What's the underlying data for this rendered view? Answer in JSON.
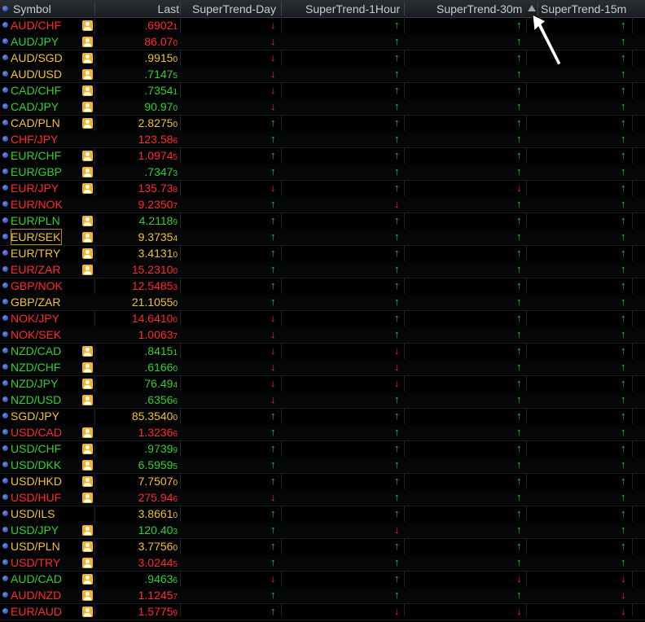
{
  "columns": {
    "symbol": "Symbol",
    "last": "Last",
    "st_day": "SuperTrend-Day",
    "st_1h": "SuperTrend-1Hour",
    "st_30m": "SuperTrend-30m",
    "st_15m": "SuperTrend-15m"
  },
  "colors": {
    "red": "#ff2a2a",
    "green": "#2ed12e",
    "orange": "#f2c12e"
  },
  "rows": [
    {
      "symbol": "AUD/CHF",
      "color": "red",
      "badge": true,
      "last": ".6902",
      "last_tail": "1",
      "day": "down",
      "h1": "up",
      "m30": "up",
      "m15": "up"
    },
    {
      "symbol": "AUD/JPY",
      "color": "green",
      "badge": true,
      "last": "86.07",
      "last_tail": "0",
      "last_color": "red",
      "day": "down",
      "h1": "up",
      "m30": "up",
      "m15": "up"
    },
    {
      "symbol": "AUD/SGD",
      "color": "orange",
      "badge": true,
      "last": ".9915",
      "last_tail": "0",
      "day": "down",
      "h1": "up",
      "m30": "up",
      "m15": "up"
    },
    {
      "symbol": "AUD/USD",
      "color": "orange",
      "badge": true,
      "last": ".7147",
      "last_tail": "5",
      "last_color": "green",
      "day": "down",
      "h1": "up",
      "m30": "up",
      "m15": "up"
    },
    {
      "symbol": "CAD/CHF",
      "color": "green",
      "badge": true,
      "last": ".7354",
      "last_tail": "1",
      "day": "down",
      "h1": "up",
      "m30": "up",
      "m15": "up"
    },
    {
      "symbol": "CAD/JPY",
      "color": "green",
      "badge": true,
      "last": "90.97",
      "last_tail": "0",
      "day": "down",
      "h1": "up",
      "m30": "up",
      "m15": "up"
    },
    {
      "symbol": "CAD/PLN",
      "color": "orange",
      "badge": true,
      "last": "2.8275",
      "last_tail": "0",
      "day": "up",
      "h1": "up",
      "m30": "up",
      "m15": "up"
    },
    {
      "symbol": "CHF/JPY",
      "color": "red",
      "badge": false,
      "last": "123.58",
      "last_tail": "6",
      "day": "up",
      "h1": "up",
      "m30": "up",
      "m15": "up"
    },
    {
      "symbol": "EUR/CHF",
      "color": "green",
      "badge": true,
      "last": "1.0974",
      "last_tail": "5",
      "last_color": "red",
      "day": "up",
      "h1": "up",
      "m30": "up",
      "m15": "up"
    },
    {
      "symbol": "EUR/GBP",
      "color": "green",
      "badge": true,
      "last": ".7347",
      "last_tail": "3",
      "day": "up",
      "h1": "up",
      "m30": "up",
      "m15": "up"
    },
    {
      "symbol": "EUR/JPY",
      "color": "red",
      "badge": true,
      "last": "135.73",
      "last_tail": "8",
      "day": "down",
      "h1": "up",
      "m30": "down",
      "m15": "up"
    },
    {
      "symbol": "EUR/NOK",
      "color": "red",
      "badge": false,
      "last": "9.2350",
      "last_tail": "7",
      "day": "up",
      "h1": "down",
      "m30": "up",
      "m15": "up"
    },
    {
      "symbol": "EUR/PLN",
      "color": "green",
      "badge": true,
      "last": "4.2118",
      "last_tail": "9",
      "day": "up",
      "h1": "up",
      "m30": "up",
      "m15": "up"
    },
    {
      "symbol": "EUR/SEK",
      "color": "orange",
      "badge": true,
      "last": "9.3735",
      "last_tail": "4",
      "day": "up",
      "h1": "up",
      "m30": "up",
      "m15": "up",
      "selected": true
    },
    {
      "symbol": "EUR/TRY",
      "color": "orange",
      "badge": true,
      "last": "3.4131",
      "last_tail": "0",
      "day": "up",
      "h1": "up",
      "m30": "up",
      "m15": "up"
    },
    {
      "symbol": "EUR/ZAR",
      "color": "red",
      "badge": true,
      "last": "15.2310",
      "last_tail": "0",
      "day": "up",
      "h1": "up",
      "m30": "up",
      "m15": "up"
    },
    {
      "symbol": "GBP/NOK",
      "color": "red",
      "badge": false,
      "last": "12.5485",
      "last_tail": "3",
      "day": "up",
      "h1": "up",
      "m30": "up",
      "m15": "up"
    },
    {
      "symbol": "GBP/ZAR",
      "color": "orange",
      "badge": false,
      "last": "21.1055",
      "last_tail": "0",
      "day": "up",
      "h1": "up",
      "m30": "up",
      "m15": "up"
    },
    {
      "symbol": "NOK/JPY",
      "color": "red",
      "badge": false,
      "last": "14.6410",
      "last_tail": "0",
      "day": "down",
      "h1": "up",
      "m30": "up",
      "m15": "up"
    },
    {
      "symbol": "NOK/SEK",
      "color": "red",
      "badge": false,
      "last": "1.0063",
      "last_tail": "7",
      "day": "down",
      "h1": "up",
      "m30": "up",
      "m15": "up"
    },
    {
      "symbol": "NZD/CAD",
      "color": "green",
      "badge": true,
      "last": ".8415",
      "last_tail": "1",
      "day": "down",
      "h1": "down",
      "m30": "up",
      "m15": "up"
    },
    {
      "symbol": "NZD/CHF",
      "color": "green",
      "badge": true,
      "last": ".6166",
      "last_tail": "0",
      "day": "down",
      "h1": "down",
      "m30": "up",
      "m15": "up"
    },
    {
      "symbol": "NZD/JPY",
      "color": "green",
      "badge": true,
      "last": "76.49",
      "last_tail": "4",
      "day": "down",
      "h1": "down",
      "m30": "up",
      "m15": "up"
    },
    {
      "symbol": "NZD/USD",
      "color": "green",
      "badge": true,
      "last": ".6356",
      "last_tail": "6",
      "last_color": "green",
      "day": "down",
      "h1": "up",
      "m30": "up",
      "m15": "up"
    },
    {
      "symbol": "SGD/JPY",
      "color": "orange",
      "badge": false,
      "last": "85.3540",
      "last_tail": "0",
      "day": "up",
      "h1": "up",
      "m30": "up",
      "m15": "up"
    },
    {
      "symbol": "USD/CAD",
      "color": "red",
      "badge": true,
      "last": "1.3236",
      "last_tail": "6",
      "last_color": "red",
      "day": "up",
      "h1": "up",
      "m30": "up",
      "m15": "up"
    },
    {
      "symbol": "USD/CHF",
      "color": "green",
      "badge": true,
      "last": ".9739",
      "last_tail": "9",
      "day": "up",
      "h1": "up",
      "m30": "up",
      "m15": "up"
    },
    {
      "symbol": "USD/DKK",
      "color": "green",
      "badge": true,
      "last": "6.5959",
      "last_tail": "5",
      "day": "up",
      "h1": "up",
      "m30": "up",
      "m15": "up"
    },
    {
      "symbol": "USD/HKD",
      "color": "orange",
      "badge": true,
      "last": "7.7507",
      "last_tail": "0",
      "day": "up",
      "h1": "up",
      "m30": "up",
      "m15": "up"
    },
    {
      "symbol": "USD/HUF",
      "color": "red",
      "badge": true,
      "last": "275.94",
      "last_tail": "6",
      "day": "down",
      "h1": "up",
      "m30": "up",
      "m15": "up"
    },
    {
      "symbol": "USD/ILS",
      "color": "orange",
      "badge": false,
      "last": "3.8661",
      "last_tail": "0",
      "day": "up",
      "h1": "up",
      "m30": "up",
      "m15": "up"
    },
    {
      "symbol": "USD/JPY",
      "color": "green",
      "badge": true,
      "last": "120.40",
      "last_tail": "3",
      "day": "up",
      "h1": "down",
      "m30": "up",
      "m15": "up"
    },
    {
      "symbol": "USD/PLN",
      "color": "orange",
      "badge": true,
      "last": "3.7756",
      "last_tail": "0",
      "day": "up",
      "h1": "up",
      "m30": "up",
      "m15": "up"
    },
    {
      "symbol": "USD/TRY",
      "color": "red",
      "badge": true,
      "last": "3.0244",
      "last_tail": "5",
      "day": "up",
      "h1": "up",
      "m30": "up",
      "m15": "up"
    },
    {
      "symbol": "AUD/CAD",
      "color": "green",
      "badge": true,
      "last": ".9463",
      "last_tail": "6",
      "day": "down",
      "h1": "up",
      "m30": "down",
      "m15": "down"
    },
    {
      "symbol": "AUD/NZD",
      "color": "red",
      "badge": true,
      "last": "1.1245",
      "last_tail": "7",
      "day": "up",
      "h1": "up",
      "m30": "up",
      "m15": "down"
    },
    {
      "symbol": "EUR/AUD",
      "color": "red",
      "badge": true,
      "last": "1.5775",
      "last_tail": "9",
      "day": "up",
      "h1": "down",
      "m30": "down",
      "m15": "down"
    }
  ]
}
